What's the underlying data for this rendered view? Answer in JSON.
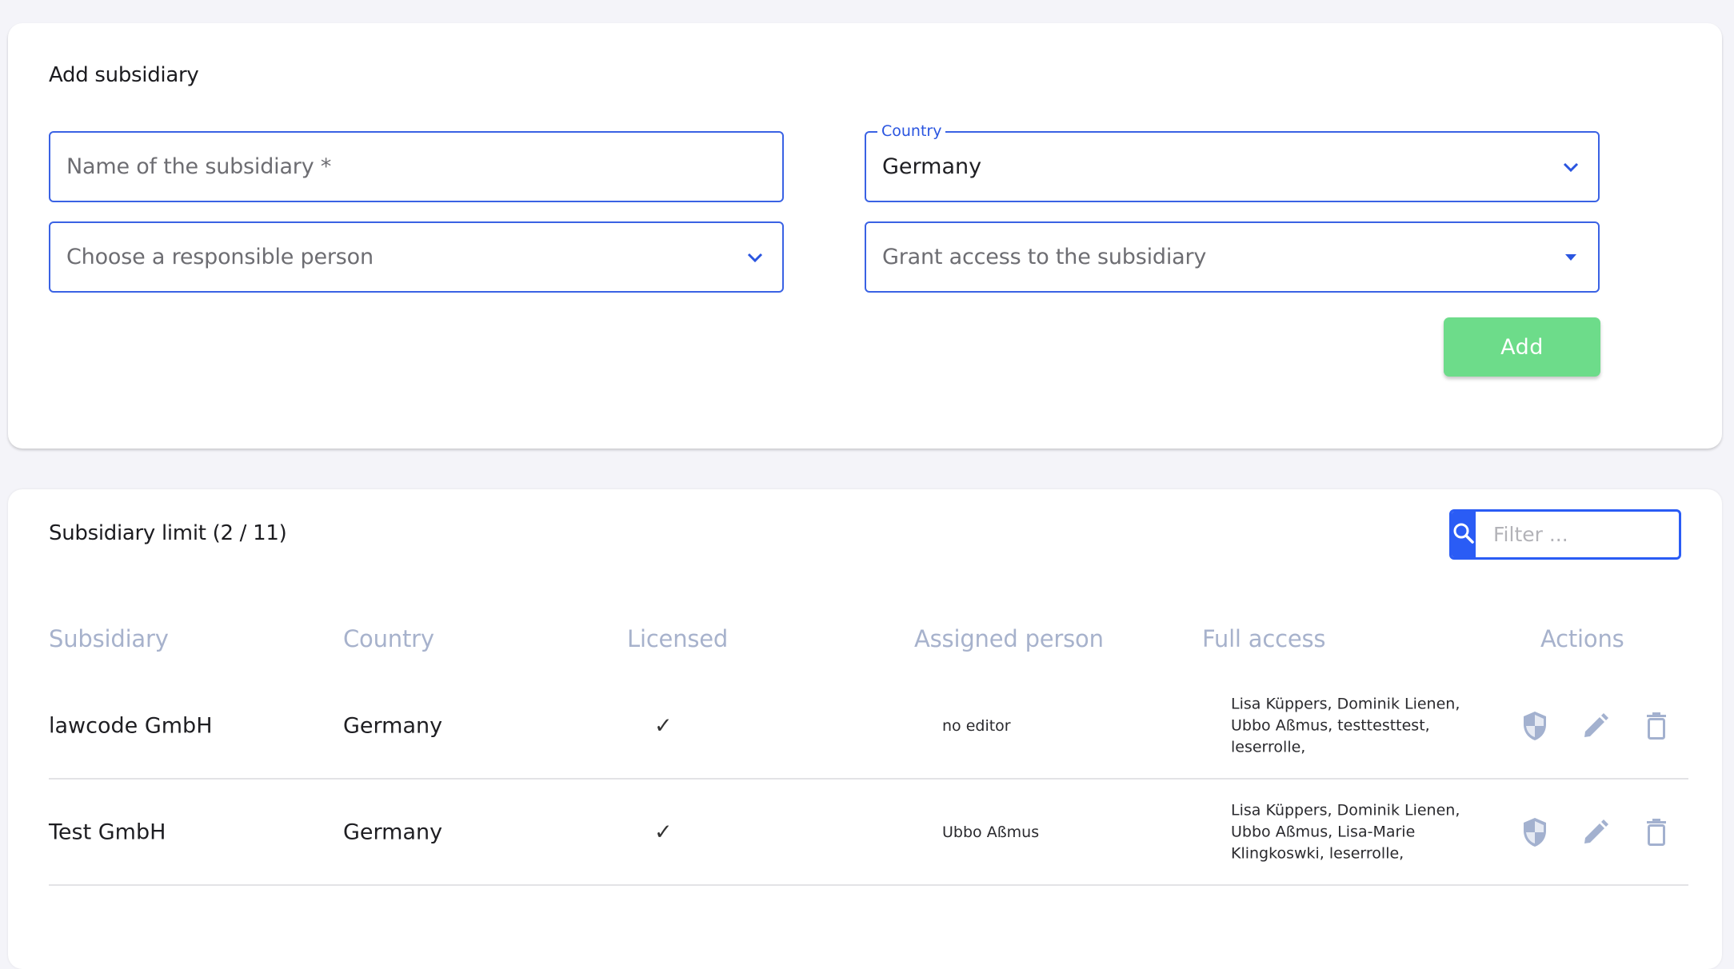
{
  "add_card": {
    "title": "Add subsidiary",
    "name_field": {
      "placeholder": "Name of the subsidiary *",
      "value": ""
    },
    "country_field": {
      "label": "Country",
      "value": "Germany"
    },
    "person_field": {
      "placeholder": "Choose a responsible person"
    },
    "access_field": {
      "placeholder": "Grant access to the subsidiary"
    },
    "add_button": "Add"
  },
  "list_card": {
    "title": "Subsidiary limit (2 / 11)",
    "filter": {
      "placeholder": "Filter ...",
      "value": ""
    },
    "columns": [
      "Subsidiary",
      "Country",
      "Licensed",
      "Assigned person",
      "Full access",
      "Actions"
    ],
    "rows": [
      {
        "subsidiary": "lawcode GmbH",
        "country": "Germany",
        "licensed": "✓",
        "assigned_person": "no editor",
        "full_access": "Lisa Küppers, Dominik Lienen, Ubbo Aßmus, testtesttest, leserrolle,"
      },
      {
        "subsidiary": "Test GmbH",
        "country": "Germany",
        "licensed": "✓",
        "assigned_person": "Ubbo Aßmus",
        "full_access": "Lisa Küppers, Dominik Lienen, Ubbo Aßmus, Lisa-Marie Klingkoswki, leserrolle,"
      }
    ],
    "action_icons": [
      "shield-icon",
      "pencil-icon",
      "trash-icon"
    ]
  },
  "colors": {
    "accent": "#2a5cf5",
    "field_border": "#3a62e4",
    "add_button": "#6ddc8a",
    "header_text": "#a7b2cc",
    "action_icon": "#a3b1cf",
    "background": "#f4f4f9"
  }
}
